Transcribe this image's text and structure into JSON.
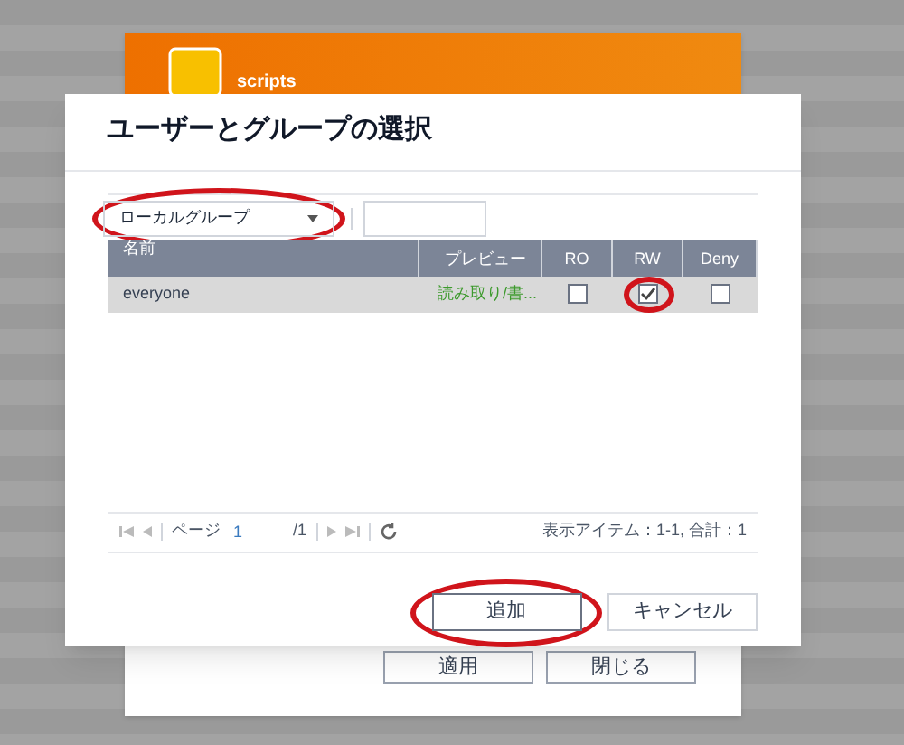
{
  "back_window": {
    "title": "scripts",
    "buttons": [
      {
        "label": "適用"
      },
      {
        "label": "閉じる"
      }
    ]
  },
  "dialog": {
    "title": "ユーザーとグループの選択",
    "filter": {
      "value": "ローカルグループ"
    },
    "table": {
      "columns": [
        "名前",
        "プレビュー",
        "RO",
        "RW",
        "Deny"
      ],
      "rows": [
        {
          "name": "everyone",
          "preview": "読み取り/書...",
          "selected": true,
          "ro": false,
          "rw": true,
          "deny": false
        }
      ]
    },
    "pager": {
      "page_label": "ページ",
      "page": "1",
      "total": "/1",
      "summary": "表示アイテム：1-1, 合計：1"
    },
    "buttons": [
      {
        "label": "追加",
        "highlighted": true
      },
      {
        "label": "キャンセル",
        "highlighted": false
      }
    ]
  }
}
